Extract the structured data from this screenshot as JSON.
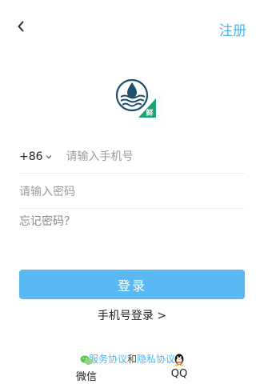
{
  "header": {
    "back_icon": "chevron-left-icon",
    "register_label": "注册"
  },
  "logo": {
    "badge_text": "鲜"
  },
  "phone": {
    "country_code": "+86",
    "placeholder": "请输入手机号",
    "value": ""
  },
  "password": {
    "placeholder": "请输入密码",
    "value": ""
  },
  "forgot_label": "忘记密码？",
  "login_label": "登录",
  "phone_login_label": "手机号登录 >",
  "agreement": {
    "service_label": "服务协议",
    "conjunction": "和",
    "privacy_label": "隐私协议"
  },
  "social": {
    "wechat_label": "微信",
    "qq_label": "QQ"
  },
  "colors": {
    "accent": "#4db5ee",
    "button": "#5ab8f2",
    "logo_navy": "#1f4f6b",
    "logo_green": "#1aa374",
    "wechat_green": "#5cc54a"
  }
}
